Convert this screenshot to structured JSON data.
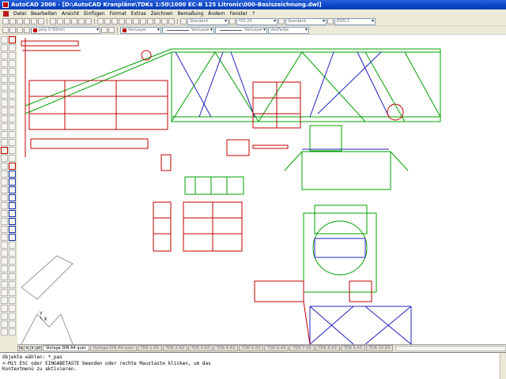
{
  "window": {
    "title": "AutoCAD 2006 - [D:\\AutoCAD Kranpläne\\TDKs 1:50\\1000 EC-B 125 Litronic\\000-Basiszeichnung.dwl]"
  },
  "menubar": {
    "items": [
      "Datei",
      "Bearbeiten",
      "Ansicht",
      "Einfügen",
      "Format",
      "Extras",
      "Zeichnen",
      "Bemaßung",
      "Ändern",
      "Fenster",
      "?"
    ]
  },
  "toolbar_styles": {
    "text_style": "Standard",
    "dim_style": "ISO-25",
    "table_style": "Standard",
    "plot_style": "ESPC1"
  },
  "toolbar_layers": {
    "layer_name": "poly 0.50mm",
    "color": "VonLayer",
    "linetype": "VonLayer",
    "lineweight": "VonLayer",
    "plotstyle": "VonFarbe"
  },
  "layout_tabs": {
    "items": [
      "Vorlage DIN A4 quer",
      "Vorlage DIN A4 quer",
      "TDK 1 A3",
      "TDK 2 A3",
      "TDK 3 A3",
      "TDK 4 A3",
      "TDK 5 A3",
      "TDK 6 A3",
      "TDK 7 A3",
      "TDK 8 A3",
      "TDK 9 A3",
      "TDK 10 A3"
    ]
  },
  "command_line": {
    "lines": [
      "Objekte wählen: *_pas",
      "<-Mit ESC oder EINGABETASTE beenden oder rechte Maustaste klicken, um das",
      "Kontextmenü zu aktivieren."
    ]
  },
  "colors": {
    "accent_red": "#c00000",
    "line_green": "#00a000",
    "line_blue": "#2020c0",
    "line_red": "#c00000"
  }
}
